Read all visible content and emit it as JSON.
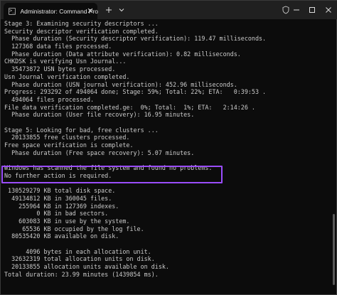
{
  "window": {
    "tab_title": "Administrator: Command Pro",
    "tab_icon": "terminal-icon",
    "new_tab_symbol": "+",
    "dropdown_symbol": "⌄",
    "shield_icon": "shield-icon",
    "minimize_symbol": "—",
    "maximize_symbol": "☐",
    "close_symbol": "✕"
  },
  "terminal": {
    "lines": [
      "Stage 3: Examining security descriptors ...",
      "Security descriptor verification completed.",
      "  Phase duration (Security descriptor verification): 119.47 milliseconds.",
      "  127368 data files processed.",
      "  Phase duration (Data attribute verification): 0.82 milliseconds.",
      "CHKDSK is verifying Usn Journal...",
      "  35473872 USN bytes processed.",
      "Usn Journal verification completed.",
      "  Phase duration (USN journal verification): 452.96 milliseconds.",
      "Progress: 293292 of 494064 done; Stage: 59%; Total: 22%; ETA:   0:39:53 .",
      "  494064 files processed.",
      "File data verification completed.ge:  0%; Total:  1%; ETA:   2:14:26 .",
      "  Phase duration (User file recovery): 16.95 minutes.",
      "",
      "Stage 5: Looking for bad, free clusters ...",
      "  20133855 free clusters processed.",
      "Free space verification is complete.",
      "  Phase duration (Free space recovery): 5.07 minutes.",
      "",
      "Windows has scanned the file system and found no problems.",
      "No further action is required.",
      "",
      " 130529279 KB total disk space.",
      "  49134812 KB in 360045 files.",
      "    255964 KB in 127369 indexes.",
      "         0 KB in bad sectors.",
      "    603083 KB in use by the system.",
      "     65536 KB occupied by the log file.",
      "  80535420 KB available on disk.",
      "",
      "      4096 bytes in each allocation unit.",
      "  32632319 total allocation units on disk.",
      "  20133855 allocation units available on disk.",
      "Total duration: 23.99 minutes (1439854 ms)."
    ]
  },
  "colors": {
    "terminal_bg": "#0c0c0c",
    "terminal_text": "#cccccc",
    "titlebar_bg": "#202020",
    "highlight_border": "#9b4dff"
  }
}
